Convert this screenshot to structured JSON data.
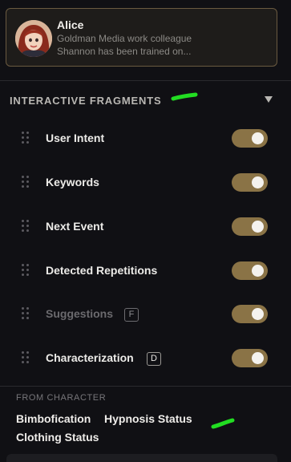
{
  "character": {
    "name": "Alice",
    "subtitle": "Goldman Media work colleague",
    "description": "Shannon has been trained on..."
  },
  "section": {
    "title": "INTERACTIVE FRAGMENTS",
    "collapse_icon": "triangle-down-icon"
  },
  "fragments": [
    {
      "label": "User Intent",
      "enabled": true,
      "shortcut": ""
    },
    {
      "label": "Keywords",
      "enabled": true,
      "shortcut": ""
    },
    {
      "label": "Next Event",
      "enabled": true,
      "shortcut": ""
    },
    {
      "label": "Detected Repetitions",
      "enabled": true,
      "shortcut": ""
    },
    {
      "label": "Suggestions",
      "enabled": true,
      "shortcut": "F",
      "dimmed": true
    },
    {
      "label": "Characterization",
      "enabled": true,
      "shortcut": "D"
    }
  ],
  "from_character": {
    "title": "FROM CHARACTER",
    "tags": [
      "Bimbofication",
      "Hypnosis Status",
      "Clothing Status"
    ]
  },
  "colors": {
    "toggle_on": "#8a7346",
    "card_border": "#6a5a40",
    "annotation_green": "#22dd22"
  }
}
